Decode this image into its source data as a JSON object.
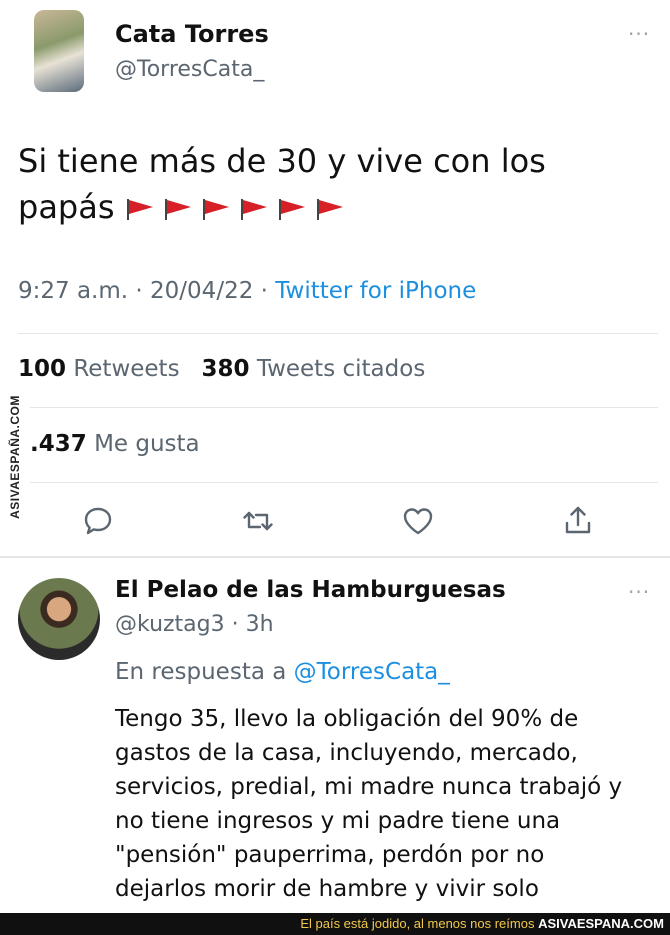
{
  "tweet": {
    "author_name": "Cata Torres",
    "author_handle": "@TorresCata_",
    "more_icon": "more-dots-icon",
    "text": "Si tiene más de 30 y vive con los papás",
    "flag_icon": "red-flag-icon",
    "flag_count": 6,
    "flag_color": "#d61f26",
    "time": "9:27 a.m.",
    "date": "20/04/22",
    "source": "Twitter for iPhone",
    "retweets_count": "100",
    "retweets_label": "Retweets",
    "quotes_count": "380",
    "quotes_label": "Tweets citados",
    "likes_count": ".437",
    "likes_label": "Me gusta",
    "actions": [
      "reply-icon",
      "retweet-icon",
      "like-icon",
      "share-icon"
    ]
  },
  "reply": {
    "author_name": "El Pelao de las Hamburguesas",
    "author_handle": "@kuztag3",
    "age": "3h",
    "in_reply_prefix": "En respuesta a",
    "in_reply_mention": "@TorresCata_",
    "lines": [
      "Tengo 35, llevo la obligación del 90% de",
      "gastos de la casa, incluyendo, mercado,",
      "servicios, predial, mi madre nunca trabajó y",
      "no tiene ingresos y mi padre tiene una",
      "\"pensión\" pauperrima, perdón por no",
      "dejarlos morir de hambre y vivir solo"
    ]
  },
  "watermark": {
    "side_text": "ASIVAESPAÑA.COM",
    "footer_caption": "El país está jodido, al menos nos reímos",
    "footer_brand": "ASIVAESPANA.COM"
  },
  "colors": {
    "link_blue": "#1d8fe0",
    "meta_gray": "#5b6670",
    "text": "#111111"
  }
}
